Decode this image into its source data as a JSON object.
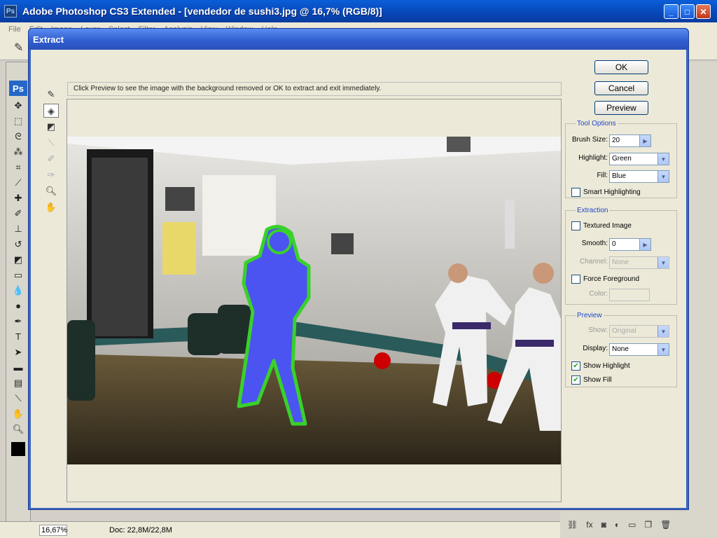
{
  "app": {
    "title": "Adobe Photoshop CS3 Extended - [vendedor de sushi3.jpg @ 16,7% (RGB/8)]",
    "menu": [
      "File",
      "Edit",
      "Image",
      "Layer",
      "Select",
      "Filter",
      "Analysis",
      "View",
      "Window",
      "Help"
    ],
    "ps_badge": "Ps",
    "status": {
      "zoom": "16,67%",
      "doc": "Doc: 22,8M/22,8M"
    }
  },
  "dialog": {
    "title": "Extract",
    "hint": "Click Preview to see the image with the background removed or OK to extract and exit immediately.",
    "buttons": {
      "ok": "OK",
      "cancel": "Cancel",
      "preview": "Preview"
    },
    "tool_options": {
      "legend": "Tool Options",
      "brush_size_label": "Brush Size:",
      "brush_size": "20",
      "highlight_label": "Highlight:",
      "highlight": "Green",
      "fill_label": "Fill:",
      "fill": "Blue",
      "smart_highlighting": "Smart Highlighting"
    },
    "extraction": {
      "legend": "Extraction",
      "textured_image": "Textured Image",
      "smooth_label": "Smooth:",
      "smooth": "0",
      "channel_label": "Channel:",
      "channel": "None",
      "force_foreground": "Force Foreground",
      "color_label": "Color:"
    },
    "preview": {
      "legend": "Preview",
      "show_label": "Show:",
      "show": "Original",
      "display_label": "Display:",
      "display": "None",
      "show_highlight": "Show Highlight",
      "show_fill": "Show Fill"
    }
  },
  "colors": {
    "highlight": "#39d12b",
    "fill": "#4b54f0",
    "accent": "#1f46c8"
  }
}
